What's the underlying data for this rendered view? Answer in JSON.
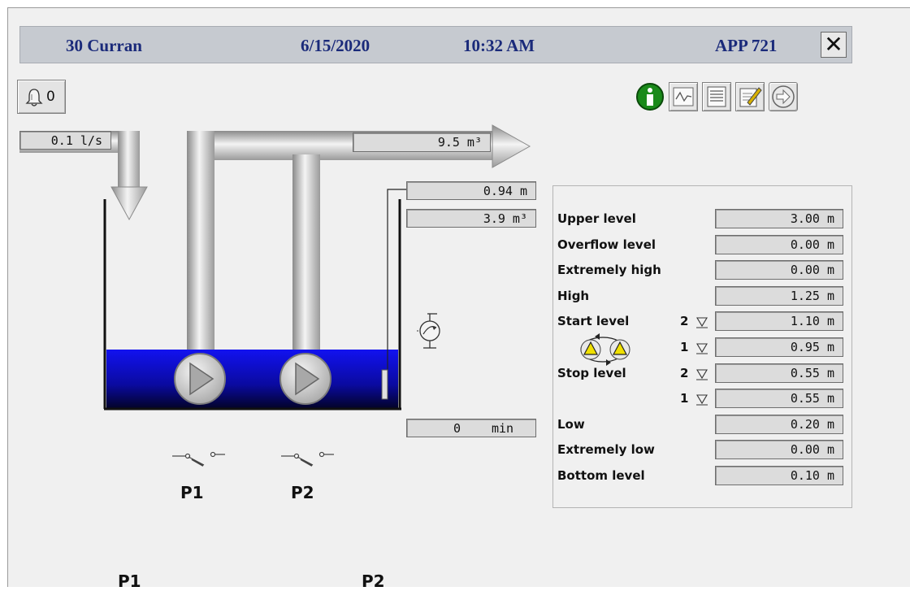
{
  "header": {
    "station": "30 Curran",
    "date": "6/15/2020",
    "time": "10:32 AM",
    "app": "APP 721",
    "close_glyph": "✕"
  },
  "alarm": {
    "count": "0",
    "icon": "bell-icon"
  },
  "toolbar": {
    "icons": [
      "info-icon",
      "trend-icon",
      "list-icon",
      "edit-notes-icon",
      "next-arrow-icon"
    ]
  },
  "flow": {
    "inflow": "0.1 l/s",
    "outflow_volume": "9.5 m³"
  },
  "tank": {
    "level": "0.94 m",
    "volume": "3.9  m³",
    "timer_value": "0",
    "timer_unit": "min"
  },
  "pumps": [
    {
      "label": "P1"
    },
    {
      "label": "P2"
    }
  ],
  "bottom_labels": [
    "P1",
    "P2"
  ],
  "levels": {
    "rows": [
      {
        "label": "Upper level",
        "value": "3.00 m"
      },
      {
        "label": "Overflow level",
        "value": "0.00 m"
      },
      {
        "label": "Extremely high",
        "value": "0.00 m"
      },
      {
        "label": "High",
        "value": "1.25 m"
      },
      {
        "label": "Start level",
        "pump": "2",
        "value": "1.10 m"
      },
      {
        "label": "",
        "pump": "1",
        "value": "0.95 m"
      },
      {
        "label": "Stop level",
        "pump": "2",
        "value": "0.55 m"
      },
      {
        "label": "",
        "pump": "1",
        "value": "0.55 m"
      },
      {
        "label": "Low",
        "value": "0.20 m"
      },
      {
        "label": "Extremely low",
        "value": "0.00 m"
      },
      {
        "label": "Bottom level",
        "value": "0.10 m"
      }
    ]
  },
  "colors": {
    "water": "#1010e0",
    "header_text": "#1a2a7a",
    "info_green": "#1a8a1a",
    "alternation_yellow": "#f0e000"
  }
}
